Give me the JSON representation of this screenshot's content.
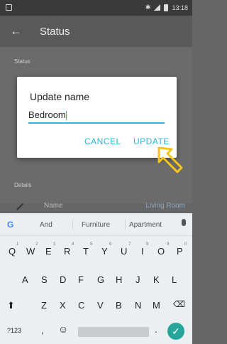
{
  "statusbar": {
    "time": "13:18"
  },
  "appbar": {
    "title": "Status"
  },
  "background": {
    "status_label": "Status",
    "details_label": "Details",
    "name_label": "Name",
    "name_value": "Living Room"
  },
  "dialog": {
    "title": "Update name",
    "value": "Bedroom",
    "cancel_label": "CANCEL",
    "update_label": "UPDATE"
  },
  "keyboard": {
    "suggestions": [
      "And",
      "Furniture",
      "Apartment"
    ],
    "row1": [
      "Q",
      "W",
      "E",
      "R",
      "T",
      "Y",
      "U",
      "I",
      "O",
      "P"
    ],
    "row1_sup": [
      "1",
      "2",
      "3",
      "4",
      "5",
      "6",
      "7",
      "8",
      "9",
      "0"
    ],
    "row2": [
      "A",
      "S",
      "D",
      "F",
      "G",
      "H",
      "J",
      "K",
      "L"
    ],
    "row3": [
      "Z",
      "X",
      "C",
      "V",
      "B",
      "N",
      "M"
    ],
    "mode_key": "?123",
    "comma": ",",
    "period": "."
  },
  "colors": {
    "accent": "#29b6d8",
    "enter": "#26a69a",
    "arrow": "#f5c518"
  }
}
